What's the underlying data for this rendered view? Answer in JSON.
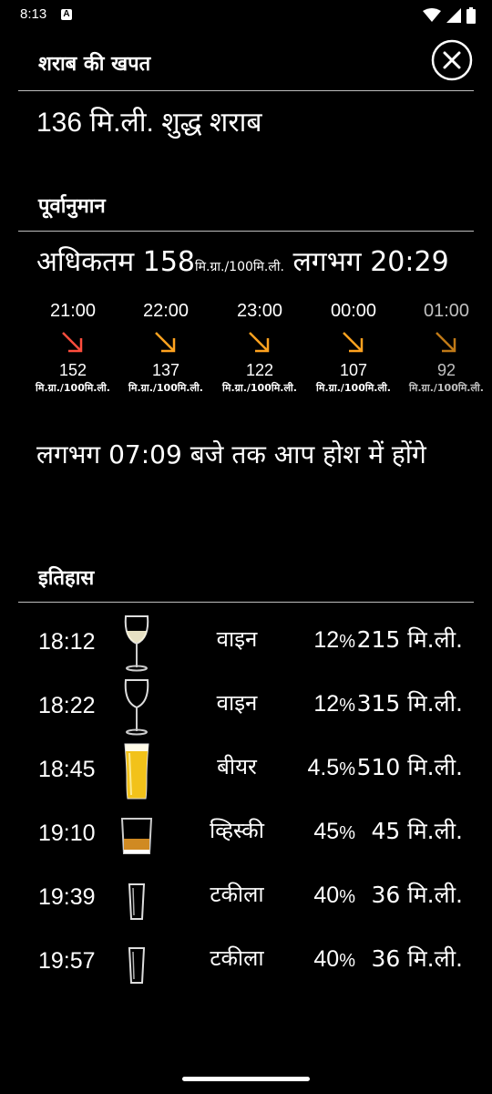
{
  "status": {
    "time": "8:13",
    "a_badge": "A"
  },
  "header": {
    "title": "शराब की खपत",
    "close_icon": "close-icon"
  },
  "total": "136 मि.ली. शुद्ध शराब",
  "forecast": {
    "title": "पूर्वानुमान",
    "peak_prefix": "अधिकतम 158",
    "peak_unit": "मि.ग्रा./100मि.ली.",
    "peak_suffix": " लगभग 20:29",
    "items": [
      {
        "time": "21:00",
        "value": "152",
        "unit": "मि.ग्रा./100मि.ली.",
        "color": "#ff4d3d"
      },
      {
        "time": "22:00",
        "value": "137",
        "unit": "मि.ग्रा./100मि.ली.",
        "color": "#ffa21f"
      },
      {
        "time": "23:00",
        "value": "122",
        "unit": "मि.ग्रा./100मि.ली.",
        "color": "#ffa21f"
      },
      {
        "time": "00:00",
        "value": "107",
        "unit": "मि.ग्रा./100मि.ली.",
        "color": "#ffa21f"
      },
      {
        "time": "01:00",
        "value": "92",
        "unit": "मि.ग्रा./100मि.ली.",
        "color": "#ffa21f"
      }
    ],
    "sober_text": "लगभग 07:09 बजे तक आप होश में होंगे"
  },
  "history": {
    "title": "इतिहास",
    "rows": [
      {
        "time": "18:12",
        "icon": "wine-glass-icon",
        "name": "वाइन",
        "pct": "12",
        "pct_sign": "%",
        "amount": "215 मि.ली."
      },
      {
        "time": "18:22",
        "icon": "wine-glass-icon",
        "name": "वाइन",
        "pct": "12",
        "pct_sign": "%",
        "amount": "315 मि.ली."
      },
      {
        "time": "18:45",
        "icon": "beer-glass-icon",
        "name": "बीयर",
        "pct": "4.5",
        "pct_sign": "%",
        "amount": "510 मि.ली."
      },
      {
        "time": "19:10",
        "icon": "whiskey-glass-icon",
        "name": "व्हिस्की",
        "pct": "45",
        "pct_sign": "%",
        "amount": "45 मि.ली."
      },
      {
        "time": "19:39",
        "icon": "shot-glass-icon",
        "name": "टकीला",
        "pct": "40",
        "pct_sign": "%",
        "amount": "36 मि.ली."
      },
      {
        "time": "19:57",
        "icon": "shot-glass-icon",
        "name": "टकीला",
        "pct": "40",
        "pct_sign": "%",
        "amount": "36 मि.ली."
      }
    ]
  }
}
